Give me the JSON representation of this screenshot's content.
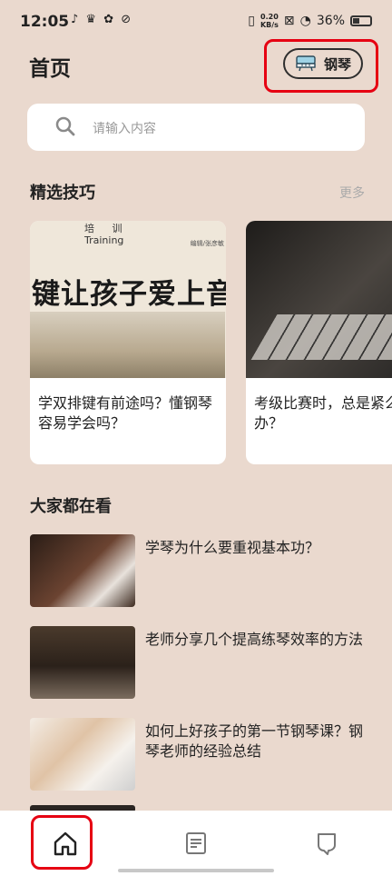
{
  "status_bar": {
    "time": "12:05",
    "app_icons": "♪ ♛ ✿ ⊘",
    "net_speed_top": "0.20",
    "net_speed_bottom": "KB/s",
    "battery": "36%"
  },
  "header": {
    "title": "首页",
    "instrument_button": "钢琴"
  },
  "search": {
    "placeholder": "请输入内容"
  },
  "featured": {
    "title": "精选技巧",
    "more": "更多",
    "cards": [
      {
        "image_top_label": "培 训",
        "image_sub_label": "Training",
        "image_byline": "编辑/张彦敏",
        "image_headline": "键让孩子爱上音乐",
        "title": "学双排键有前途吗？懂钢琴容易学会吗？"
      },
      {
        "title": "考级比赛时，总是紧么办？"
      }
    ]
  },
  "trending": {
    "title": "大家都在看",
    "items": [
      {
        "title": "学琴为什么要重视基本功？"
      },
      {
        "title": "老师分享几个提高练琴效率的方法"
      },
      {
        "title": "如何上好孩子的第一节钢琴课？钢琴老师的经验总结"
      }
    ]
  },
  "tab_bar": {
    "tabs": [
      "home-icon",
      "article-icon",
      "feedback-icon"
    ]
  },
  "colors": {
    "background": "#ead9ce",
    "highlight": "#e60012"
  }
}
